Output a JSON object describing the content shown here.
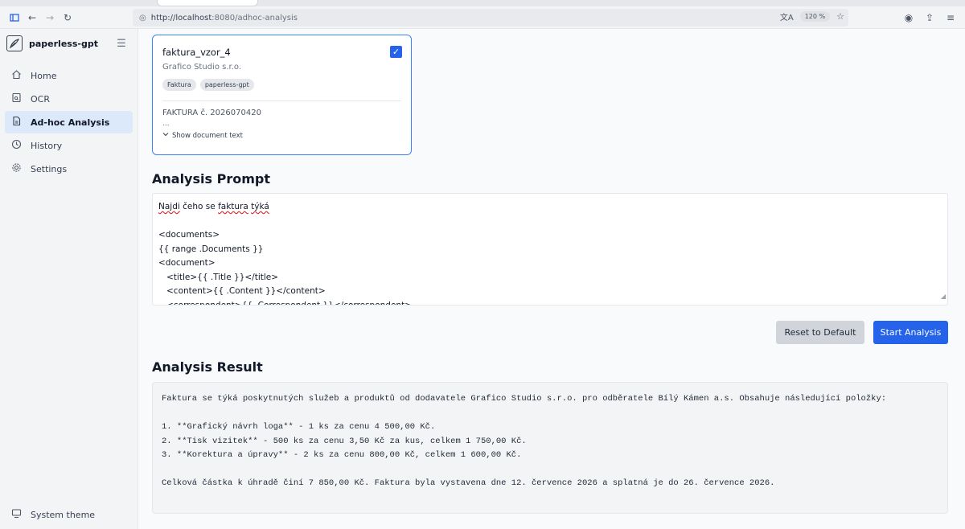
{
  "browser": {
    "url_host": "http://localhost",
    "url_path": ":8080/adhoc-analysis",
    "zoom": "120 %"
  },
  "sidebar": {
    "brand": "paperless-gpt",
    "items": [
      {
        "label": "Home",
        "icon": "home-icon"
      },
      {
        "label": "OCR",
        "icon": "ocr-icon"
      },
      {
        "label": "Ad-hoc Analysis",
        "icon": "document-icon"
      },
      {
        "label": "History",
        "icon": "clock-icon"
      },
      {
        "label": "Settings",
        "icon": "gear-icon"
      }
    ],
    "theme_label": "System theme"
  },
  "document_card": {
    "title": "faktura_vzor_4",
    "correspondent": "Grafico Studio s.r.o.",
    "tags": [
      "Faktura",
      "paperless-gpt"
    ],
    "text_preview": "FAKTURA č. 2026070420",
    "ellipsis": "...",
    "show_text_label": "Show document text",
    "selected": true
  },
  "prompt": {
    "heading": "Analysis Prompt",
    "line1_a": "Najdi",
    "line1_b": " čeho se ",
    "line1_c": "faktura",
    "line1_d": " ",
    "line1_e": "týká",
    "body": "<documents>\n{{ range .Documents }}\n<document>\n   <title>{{ .Title }}</title>\n   <content>{{ .Content }}</content>\n   <correspondent>{{ .Correspondent }}</correspondent>"
  },
  "buttons": {
    "reset": "Reset to Default",
    "start": "Start Analysis"
  },
  "result": {
    "heading": "Analysis Result",
    "text": "Faktura se týká poskytnutých služeb a produktů od dodavatele Grafico Studio s.r.o. pro odběratele Bílý Kámen a.s. Obsahuje následující položky:\n\n1. **Grafický návrh loga** - 1 ks za cenu 4 500,00 Kč.\n2. **Tisk vizitek** - 500 ks za cenu 3,50 Kč za kus, celkem 1 750,00 Kč.\n3. **Korektura a úpravy** - 2 ks za cenu 800,00 Kč, celkem 1 600,00 Kč.\n\nCelková částka k úhradě činí 7 850,00 Kč. Faktura byla vystavena dne 12. července 2026 a splatná je do 26. července 2026."
  },
  "colors": {
    "accent": "#2563eb",
    "active_nav": "#dbe9fb"
  }
}
